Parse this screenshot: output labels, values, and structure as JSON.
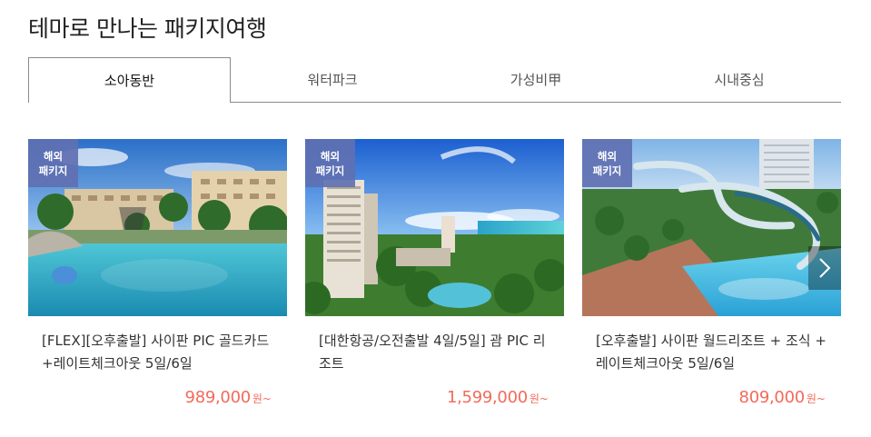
{
  "section": {
    "title": "테마로 만나는 패키지여행"
  },
  "tabs": [
    {
      "label": "소아동반",
      "active": true
    },
    {
      "label": "워터파크",
      "active": false
    },
    {
      "label": "가성비甲",
      "active": false
    },
    {
      "label": "시내중심",
      "active": false
    }
  ],
  "cards": [
    {
      "badge_line1": "해외",
      "badge_line2": "패키지",
      "title": "[FLEX][오후출발] 사이판 PIC 골드카드+레이트체크아웃 5일/6일",
      "price": "989,000",
      "unit": "원~",
      "image": "resort-pool-photo"
    },
    {
      "badge_line1": "해외",
      "badge_line2": "패키지",
      "title": "[대한항공/오전출발 4일/5일] 괌 PIC 리조트",
      "price": "1,599,000",
      "unit": "원~",
      "image": "guam-resort-photo"
    },
    {
      "badge_line1": "해외",
      "badge_line2": "패키지",
      "title": "[오후출발] 사이판 월드리조트 + 조식 + 레이트체크아웃 5일/6일",
      "price": "809,000",
      "unit": "원~",
      "image": "waterpark-photo"
    }
  ],
  "colors": {
    "accent_price": "#f26b5b",
    "badge_bg": "#6070b2"
  },
  "carousel": {
    "next_icon": "chevron-right-icon"
  }
}
